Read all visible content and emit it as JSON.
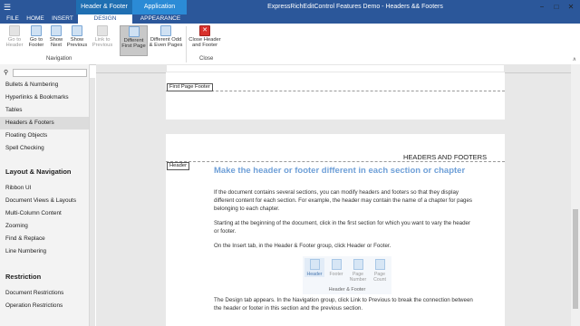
{
  "window": {
    "title": "ExpressRichEditControl Features Demo - Headers && Footers",
    "context_tool_label": "Header & Footer Tools",
    "app_options_label": "Application Options",
    "controls": [
      "−",
      "□",
      "✕"
    ]
  },
  "tabs": [
    "FILE",
    "HOME",
    "INSERT",
    "DESIGN",
    "APPEARANCE"
  ],
  "ribbon": {
    "buttons": [
      {
        "label": "Go to\nHeader",
        "enabled": false
      },
      {
        "label": "Go to\nFooter",
        "enabled": true
      },
      {
        "label": "Show\nNext",
        "enabled": true
      },
      {
        "label": "Show\nPrevious",
        "enabled": true
      },
      {
        "label": "Link to\nPrevious",
        "enabled": false
      },
      {
        "label": "Different\nFirst Page",
        "enabled": true,
        "selected": true
      },
      {
        "label": "Different Odd\n& Even Pages",
        "enabled": true
      },
      {
        "label": "Close Header\nand Footer",
        "enabled": true
      }
    ],
    "groups": [
      "Navigation",
      "Close"
    ],
    "collapse_glyph": "∧"
  },
  "sidebar": {
    "search_placeholder": "",
    "items": [
      {
        "label": "Bullets & Numbering"
      },
      {
        "label": "Hyperlinks & Bookmarks"
      },
      {
        "label": "Tables"
      },
      {
        "label": "Headers & Footers",
        "selected": true
      },
      {
        "label": "Floating Objects"
      },
      {
        "label": "Spell Checking"
      }
    ],
    "sections": [
      {
        "title": "Layout & Navigation",
        "items": [
          "Ribbon UI",
          "Document Views & Layouts",
          "Multi-Column Content",
          "Zooming",
          "Find & Replace",
          "Line Numbering"
        ]
      },
      {
        "title": "Restriction",
        "items": [
          "Document Restrictions",
          "Operation Restrictions"
        ]
      }
    ]
  },
  "document": {
    "first_page_footer_tag": "First Page Footer",
    "header_tag": "Header",
    "header_text": "HEADERS AND FOOTERS",
    "heading": "Make the header or footer different in each section or chapter",
    "para1_lines": [
      "If the document contains several sections, you can modify headers and footers so that they display",
      "different content for each section. For example, the header may contain the name of a chapter for pages",
      "belonging to each chapter."
    ],
    "para2_lines": [
      "Starting at the beginning of the document, click in the first section for which you want to vary the header",
      "or footer."
    ],
    "para3": "On the Insert tab, in the Header & Footer group, click Header or Footer.",
    "mini_group": {
      "items": [
        "Header",
        "Footer",
        "Page\nNumber",
        "Page\nCount"
      ],
      "label": "Header & Footer"
    },
    "para4_lines": [
      "The Design tab appears. In the Navigation group, click Link to Previous  to break the connection between",
      "the header or footer in this section and the previous section."
    ]
  },
  "colors": {
    "title_bar": "#2b579a",
    "context_tab": "#1f6fb2",
    "heading": "#6fa0d8",
    "close_icon": "#d9312b"
  }
}
